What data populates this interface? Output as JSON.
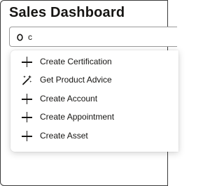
{
  "page": {
    "title": "Sales Dashboard"
  },
  "search": {
    "value": "c",
    "icon": "search-icon"
  },
  "menu": {
    "items": [
      {
        "label": "Create Certification",
        "icon": "plus-icon"
      },
      {
        "label": "Get Product Advice",
        "icon": "magic-wand-icon"
      },
      {
        "label": "Create Account",
        "icon": "plus-icon"
      },
      {
        "label": "Create Appointment",
        "icon": "plus-icon"
      },
      {
        "label": "Create Asset",
        "icon": "plus-icon"
      }
    ]
  }
}
